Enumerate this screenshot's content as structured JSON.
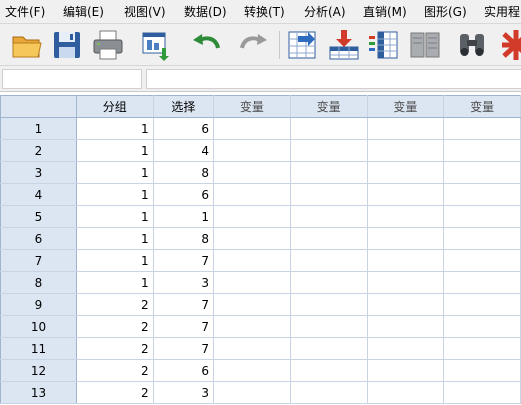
{
  "menu": [
    {
      "label": "文件(F)"
    },
    {
      "label": "编辑(E)"
    },
    {
      "label": "视图(V)"
    },
    {
      "label": "数据(D)"
    },
    {
      "label": "转换(T)"
    },
    {
      "label": "分析(A)"
    },
    {
      "label": "直销(M)"
    },
    {
      "label": "图形(G)"
    },
    {
      "label": "实用程"
    }
  ],
  "toolbar": {
    "icons": [
      "open-folder-icon",
      "save-icon",
      "print-icon",
      "recall-dialog-icon",
      "undo-icon",
      "redo-icon",
      "goto-case-icon",
      "insert-case-icon",
      "insert-variable-icon",
      "split-file-icon",
      "find-icon",
      "select-cases-icon"
    ]
  },
  "refbar": {
    "cell_ref": "",
    "cell_value": ""
  },
  "grid": {
    "columns": [
      "分组",
      "选择",
      "变量",
      "变量",
      "变量",
      "变量"
    ],
    "rows": [
      {
        "num": "1",
        "g": "1",
        "x": "6"
      },
      {
        "num": "2",
        "g": "1",
        "x": "4"
      },
      {
        "num": "3",
        "g": "1",
        "x": "8"
      },
      {
        "num": "4",
        "g": "1",
        "x": "6"
      },
      {
        "num": "5",
        "g": "1",
        "x": "1"
      },
      {
        "num": "6",
        "g": "1",
        "x": "8"
      },
      {
        "num": "7",
        "g": "1",
        "x": "7"
      },
      {
        "num": "8",
        "g": "1",
        "x": "3"
      },
      {
        "num": "9",
        "g": "2",
        "x": "7"
      },
      {
        "num": "10",
        "g": "2",
        "x": "7"
      },
      {
        "num": "11",
        "g": "2",
        "x": "7"
      },
      {
        "num": "12",
        "g": "2",
        "x": "6"
      },
      {
        "num": "13",
        "g": "2",
        "x": "3"
      }
    ]
  },
  "colors": {
    "header_bg": "#dce6f2",
    "grid_line": "#c8d4e3",
    "chrome_bg": "#f0f0f0"
  }
}
